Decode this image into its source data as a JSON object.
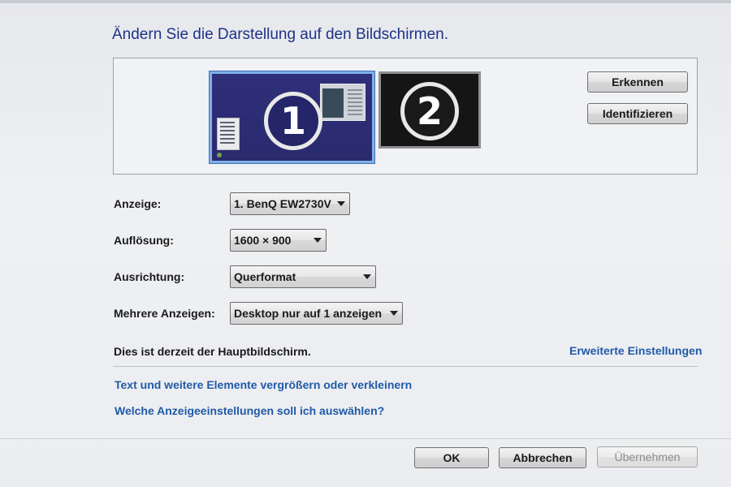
{
  "title": "Ändern Sie die Darstellung auf den Bildschirmen.",
  "monitors": [
    {
      "number": "1",
      "selected": true,
      "color": "#2d2d75"
    },
    {
      "number": "2",
      "selected": false,
      "color": "#151515"
    }
  ],
  "buttons": {
    "detect": "Erkennen",
    "identify": "Identifizieren",
    "ok": "OK",
    "cancel": "Abbrechen",
    "apply": "Übernehmen"
  },
  "fields": {
    "display": {
      "label": "Anzeige:",
      "value": "1. BenQ EW2730V"
    },
    "resolution": {
      "label": "Auflösung:",
      "value": "1600 × 900"
    },
    "orientation": {
      "label": "Ausrichtung:",
      "value": "Querformat"
    },
    "multiple": {
      "label": "Mehrere Anzeigen:",
      "value": "Desktop nur auf 1 anzeigen"
    }
  },
  "status": "Dies ist derzeit der Hauptbildschirm.",
  "links": {
    "advanced": "Erweiterte Einstellungen",
    "text_size": "Text und weitere Elemente vergrößern oder verkleinern",
    "which_settings": "Welche Anzeigeeinstellungen soll ich auswählen?"
  },
  "colors": {
    "title": "#1e3287",
    "link": "#1f5aa8",
    "selected_border": "#7fb0e8"
  }
}
